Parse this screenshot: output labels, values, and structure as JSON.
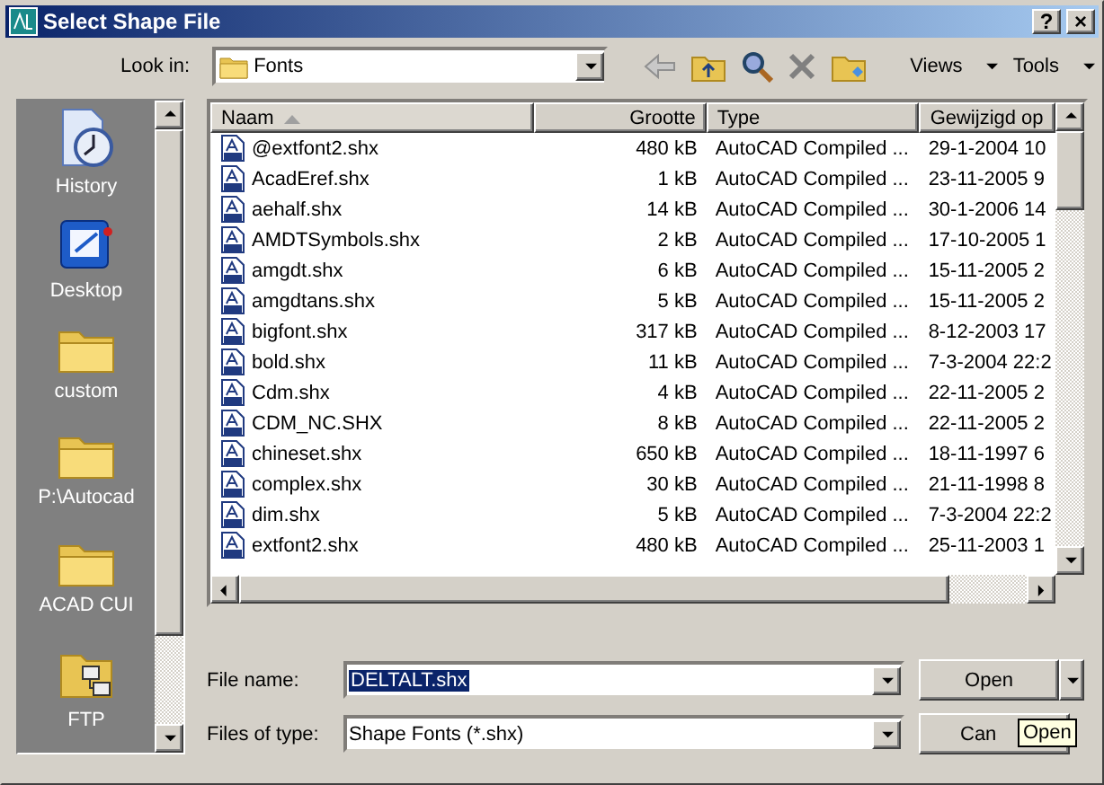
{
  "window": {
    "title": "Select Shape File",
    "help": "?",
    "close": "×"
  },
  "look_in": {
    "label": "Look in:",
    "value": "Fonts"
  },
  "toolbar": {
    "views": "Views",
    "tools": "Tools"
  },
  "places": [
    {
      "label": "History",
      "kind": "history"
    },
    {
      "label": "Desktop",
      "kind": "desktop"
    },
    {
      "label": "custom",
      "kind": "folder"
    },
    {
      "label": "P:\\Autocad",
      "kind": "folder"
    },
    {
      "label": "ACAD CUI",
      "kind": "folder"
    },
    {
      "label": "FTP",
      "kind": "ftp"
    }
  ],
  "table": {
    "columns": [
      {
        "label": "Naam",
        "sorted": true
      },
      {
        "label": "Grootte",
        "sorted": false
      },
      {
        "label": "Type",
        "sorted": false
      },
      {
        "label": "Gewijzigd op",
        "sorted": false
      }
    ],
    "rows": [
      [
        "@extfont2.shx",
        "480 kB",
        "AutoCAD Compiled ...",
        "29-1-2004 10"
      ],
      [
        "AcadEref.shx",
        "1 kB",
        "AutoCAD Compiled ...",
        "23-11-2005 9"
      ],
      [
        "aehalf.shx",
        "14 kB",
        "AutoCAD Compiled ...",
        "30-1-2006 14"
      ],
      [
        "AMDTSymbols.shx",
        "2 kB",
        "AutoCAD Compiled ...",
        "17-10-2005 1"
      ],
      [
        "amgdt.shx",
        "6 kB",
        "AutoCAD Compiled ...",
        "15-11-2005 2"
      ],
      [
        "amgdtans.shx",
        "5 kB",
        "AutoCAD Compiled ...",
        "15-11-2005 2"
      ],
      [
        "bigfont.shx",
        "317 kB",
        "AutoCAD Compiled ...",
        "8-12-2003 17"
      ],
      [
        "bold.shx",
        "11 kB",
        "AutoCAD Compiled ...",
        "7-3-2004 22:2"
      ],
      [
        "Cdm.shx",
        "4 kB",
        "AutoCAD Compiled ...",
        "22-11-2005 2"
      ],
      [
        "CDM_NC.SHX",
        "8 kB",
        "AutoCAD Compiled ...",
        "22-11-2005 2"
      ],
      [
        "chineset.shx",
        "650 kB",
        "AutoCAD Compiled ...",
        "18-11-1997 6"
      ],
      [
        "complex.shx",
        "30 kB",
        "AutoCAD Compiled ...",
        "21-11-1998 8"
      ],
      [
        "dim.shx",
        "5 kB",
        "AutoCAD Compiled ...",
        "7-3-2004 22:2"
      ],
      [
        "extfont2.shx",
        "480 kB",
        "AutoCAD Compiled ...",
        "25-11-2003 1"
      ]
    ]
  },
  "file_name": {
    "label": "File name:",
    "value": "DELTALT.shx"
  },
  "file_type": {
    "label": "Files of type:",
    "value": "Shape Fonts (*.shx)"
  },
  "buttons": {
    "open": "Open",
    "cancel": "Can"
  },
  "tooltip": "Open"
}
